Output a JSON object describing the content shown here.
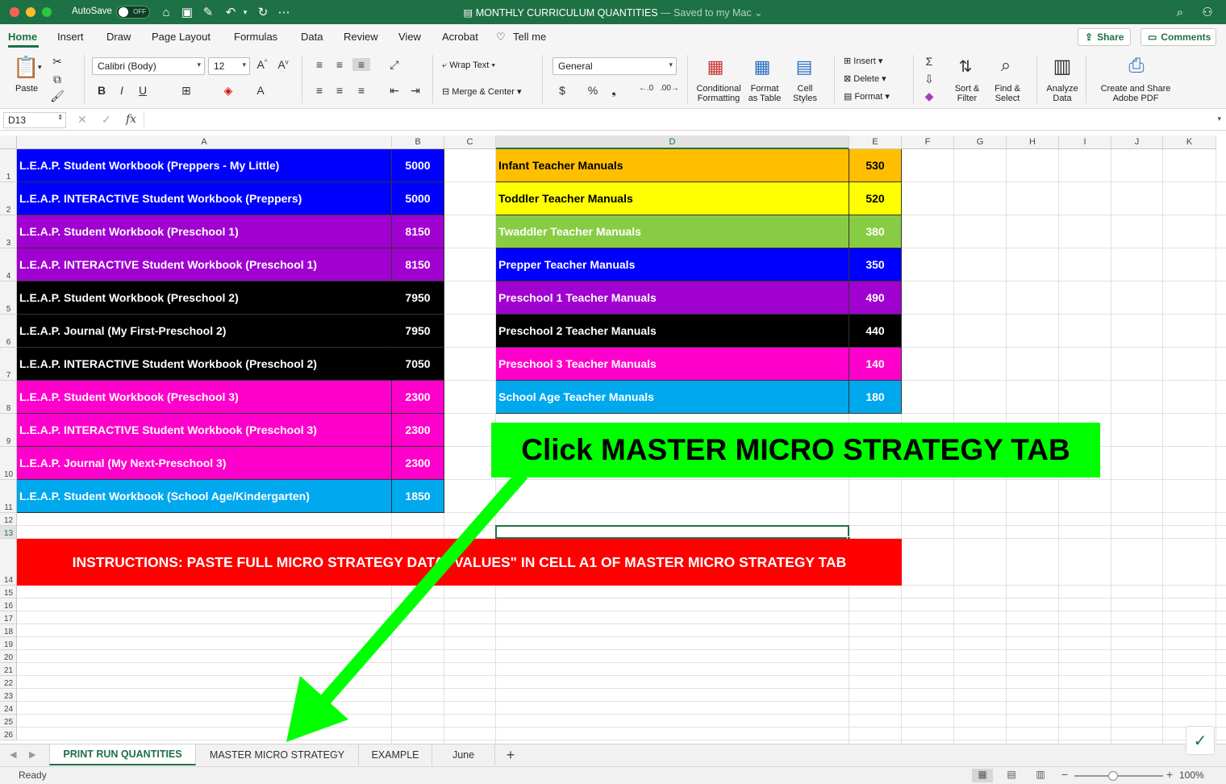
{
  "window": {
    "autosave_label": "AutoSave",
    "autosave_state": "OFF",
    "doc_title": "MONTHLY CURRICULUM QUANTITIES",
    "doc_subtitle": "— Saved to my Mac ⌄"
  },
  "ribbon_tabs": [
    "Home",
    "Insert",
    "Draw",
    "Page Layout",
    "Formulas",
    "Data",
    "Review",
    "View",
    "Acrobat",
    "Tell me"
  ],
  "share_label": "Share",
  "comments_label": "Comments",
  "ribbon": {
    "paste": "Paste",
    "font_name": "Calibri (Body)",
    "font_size": "12",
    "wrap_text": "Wrap Text",
    "merge_center": "Merge & Center",
    "number_format": "General",
    "conditional_formatting": [
      "Conditional",
      "Formatting"
    ],
    "format_as_table": [
      "Format",
      "as Table"
    ],
    "cell_styles": [
      "Cell",
      "Styles"
    ],
    "insert": "Insert",
    "delete": "Delete",
    "format": "Format",
    "sort_filter": [
      "Sort &",
      "Filter"
    ],
    "find_select": [
      "Find &",
      "Select"
    ],
    "analyze_data": [
      "Analyze",
      "Data"
    ],
    "create_share_pdf": [
      "Create and Share",
      "Adobe PDF"
    ]
  },
  "formula_bar": {
    "name_box": "D13",
    "fx": "fx",
    "value": ""
  },
  "columns": [
    "A",
    "B",
    "C",
    "D",
    "E",
    "F",
    "G",
    "H",
    "I",
    "J",
    "K"
  ],
  "rows": [
    "1",
    "2",
    "3",
    "4",
    "5",
    "6",
    "7",
    "8",
    "9",
    "10",
    "11",
    "12",
    "13",
    "14",
    "15",
    "16",
    "17",
    "18",
    "19",
    "20",
    "21",
    "22",
    "23",
    "24",
    "25",
    "26"
  ],
  "left_table": [
    {
      "label": "L.E.A.P. Student Workbook (Preppers - My Little)",
      "value": "5000",
      "color": "#0000ff"
    },
    {
      "label": "L.E.A.P. INTERACTIVE Student Workbook (Preppers)",
      "value": "5000",
      "color": "#0000ff"
    },
    {
      "label": "L.E.A.P. Student Workbook (Preschool 1)",
      "value": "8150",
      "color": "#a000d0"
    },
    {
      "label": "L.E.A.P. INTERACTIVE Student Workbook (Preschool 1)",
      "value": "8150",
      "color": "#a000d0"
    },
    {
      "label": "L.E.A.P. Student Workbook (Preschool 2)",
      "value": "7950",
      "color": "#000000"
    },
    {
      "label": "L.E.A.P. Journal (My First-Preschool 2)",
      "value": "7950",
      "color": "#000000"
    },
    {
      "label": "L.E.A.P. INTERACTIVE Student Workbook (Preschool 2)",
      "value": "7050",
      "color": "#000000"
    },
    {
      "label": "L.E.A.P. Student Workbook (Preschool 3)",
      "value": "2300",
      "color": "#ff00cc"
    },
    {
      "label": "L.E.A.P. INTERACTIVE Student Workbook (Preschool 3)",
      "value": "2300",
      "color": "#ff00cc"
    },
    {
      "label": "L.E.A.P. Journal (My Next-Preschool 3)",
      "value": "2300",
      "color": "#ff00cc"
    },
    {
      "label": "L.E.A.P. Student Workbook (School Age/Kindergarten)",
      "value": "1850",
      "color": "#00a8ee"
    }
  ],
  "right_table": [
    {
      "label": "Infant Teacher Manuals",
      "value": "530",
      "color": "#ffbf00",
      "text": "#000000"
    },
    {
      "label": "Toddler Teacher Manuals",
      "value": "520",
      "color": "#ffff00",
      "text": "#000000"
    },
    {
      "label": "Twaddler Teacher Manuals",
      "value": "380",
      "color": "#88cc44",
      "text": "#ffffff"
    },
    {
      "label": "Prepper Teacher Manuals",
      "value": "350",
      "color": "#0000ff",
      "text": "#ffffff"
    },
    {
      "label": "Preschool 1 Teacher Manuals",
      "value": "490",
      "color": "#a000d0",
      "text": "#ffffff"
    },
    {
      "label": "Preschool 2 Teacher Manuals",
      "value": "440",
      "color": "#000000",
      "text": "#ffffff"
    },
    {
      "label": "Preschool 3 Teacher Manuals",
      "value": "140",
      "color": "#ff00cc",
      "text": "#ffffff"
    },
    {
      "label": "School Age Teacher Manuals",
      "value": "180",
      "color": "#00a8ee",
      "text": "#ffffff"
    }
  ],
  "instructions": "INSTRUCTIONS:  PASTE FULL MICRO STRATEGY DATA \"VALUES\" IN CELL A1 OF MASTER MICRO STRATEGY TAB",
  "callout": "Click MASTER MICRO STRATEGY TAB",
  "sheet_tabs": [
    "PRINT RUN QUANTITIES",
    "MASTER MICRO STRATEGY",
    "EXAMPLE",
    "June"
  ],
  "status": "Ready",
  "zoom": "100%"
}
